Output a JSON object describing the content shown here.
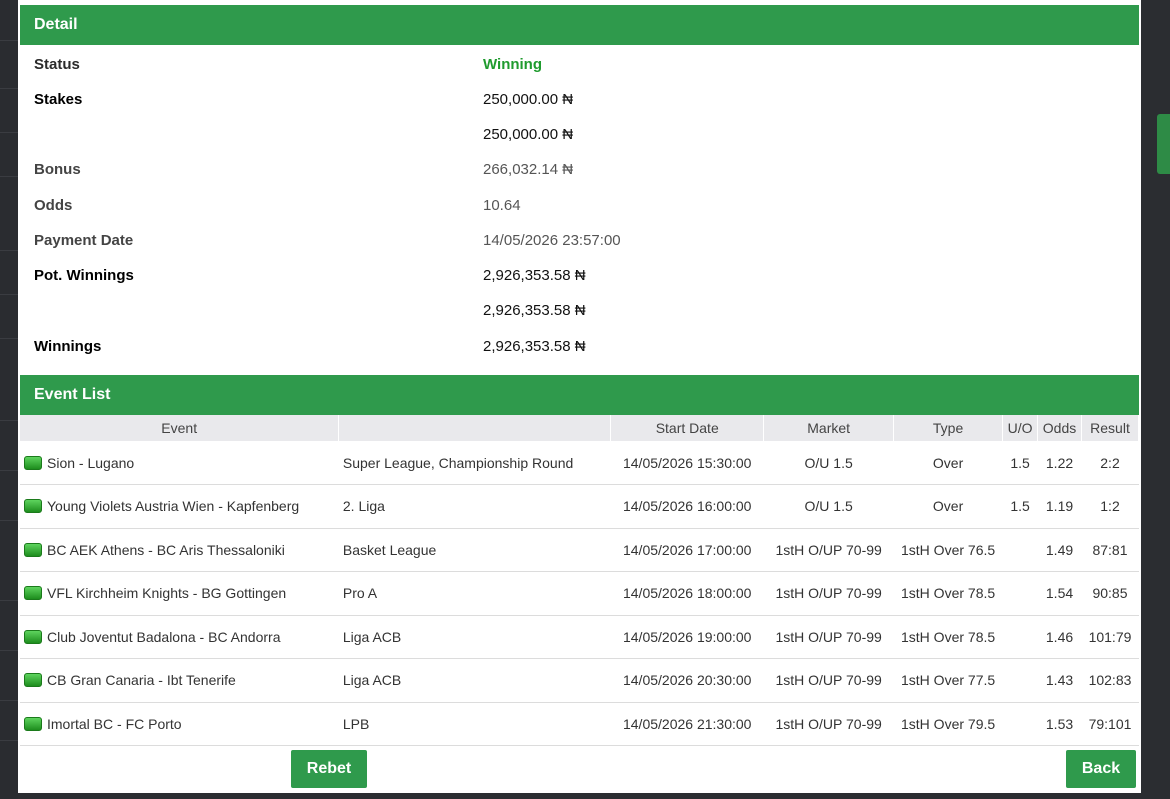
{
  "detail": {
    "title": "Detail",
    "rows": [
      {
        "label": "Status",
        "value": "Winning"
      },
      {
        "label": "Stakes",
        "value": "250,000.00 ₦"
      },
      {
        "label": "",
        "value": "250,000.00 ₦"
      },
      {
        "label": "Bonus",
        "value": "266,032.14 ₦"
      },
      {
        "label": "Odds",
        "value": "10.64"
      },
      {
        "label": "Payment Date",
        "value": "14/05/2026 23:57:00"
      },
      {
        "label": "Pot. Winnings",
        "value": "2,926,353.58 ₦"
      },
      {
        "label": "",
        "value": "2,926,353.58 ₦"
      },
      {
        "label": "Winnings",
        "value": "2,926,353.58 ₦"
      }
    ]
  },
  "event_list": {
    "title": "Event List",
    "columns": [
      "Event",
      "",
      "Start Date",
      "Market",
      "Type",
      "U/O",
      "Odds",
      "Result"
    ],
    "rows": [
      {
        "event": "Sion - Lugano",
        "league": "Super League, Championship Round",
        "start": "14/05/2026 15:30:00",
        "market": "O/U 1.5",
        "type": "Over",
        "uo": "1.5",
        "odds": "1.22",
        "result": "2:2"
      },
      {
        "event": "Young Violets Austria Wien - Kapfenberg",
        "league": "2. Liga",
        "start": "14/05/2026 16:00:00",
        "market": "O/U 1.5",
        "type": "Over",
        "uo": "1.5",
        "odds": "1.19",
        "result": "1:2"
      },
      {
        "event": "BC AEK Athens - BC Aris Thessaloniki",
        "league": "Basket League",
        "start": "14/05/2026 17:00:00",
        "market": "1stH O/UP 70-99",
        "type": "1stH Over 76.5",
        "uo": "",
        "odds": "1.49",
        "result": "87:81"
      },
      {
        "event": "VFL Kirchheim Knights - BG Gottingen",
        "league": "Pro A",
        "start": "14/05/2026 18:00:00",
        "market": "1stH O/UP 70-99",
        "type": "1stH Over 78.5",
        "uo": "",
        "odds": "1.54",
        "result": "90:85"
      },
      {
        "event": "Club Joventut Badalona - BC Andorra",
        "league": "Liga ACB",
        "start": "14/05/2026 19:00:00",
        "market": "1stH O/UP 70-99",
        "type": "1stH Over 78.5",
        "uo": "",
        "odds": "1.46",
        "result": "101:79"
      },
      {
        "event": "CB Gran Canaria - Ibt Tenerife",
        "league": "Liga ACB",
        "start": "14/05/2026 20:30:00",
        "market": "1stH O/UP 70-99",
        "type": "1stH Over 77.5",
        "uo": "",
        "odds": "1.43",
        "result": "102:83"
      },
      {
        "event": "Imortal BC - FC Porto",
        "league": "LPB",
        "start": "14/05/2026 21:30:00",
        "market": "1stH O/UP 70-99",
        "type": "1stH Over 79.5",
        "uo": "",
        "odds": "1.53",
        "result": "79:101"
      }
    ]
  },
  "buttons": {
    "rebet": "Rebet",
    "back": "Back"
  },
  "colors": {
    "accent": "#2f9a4c",
    "status_winning": "#1f9b2e",
    "table_header_bg": "#e9e9ec"
  }
}
